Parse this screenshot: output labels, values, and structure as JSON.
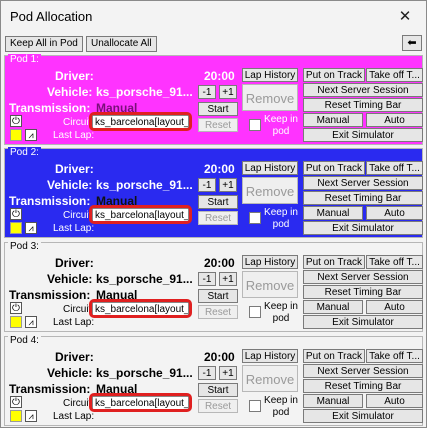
{
  "window": {
    "title": "Pod Allocation",
    "close_glyph": "✕"
  },
  "toolbar": {
    "keep_all_label": "Keep All in Pod",
    "unallocate_label": "Unallocate All",
    "back_glyph": "⬅"
  },
  "labels": {
    "driver": "Driver:",
    "vehicle": "Vehicle:",
    "transmission": "Transmission:",
    "circuit": "Circuit:",
    "last_lap": "Last Lap:",
    "lap_history": "Lap History",
    "minus": "-1",
    "plus": "+1",
    "start": "Start",
    "reset": "Reset",
    "remove": "Remove",
    "keep_in_pod": "Keep in pod",
    "put_on_track": "Put on Track",
    "take_off": "Take off T...",
    "next_server_session": "Next Server Session",
    "reset_timing_bar": "Reset Timing Bar",
    "manual_btn": "Manual",
    "auto_btn": "Auto",
    "exit_simulator": "Exit Simulator"
  },
  "pods": [
    {
      "label": "Pod 1:",
      "color": "#ff33ff",
      "driver": "",
      "vehicle": "ks_porsche_91...",
      "transmission": "Manual",
      "circuit": "ks_barcelona[layout_...",
      "last_lap": "",
      "time": "20:00"
    },
    {
      "label": "Pod 2:",
      "color": "#2a2af0",
      "driver": "",
      "vehicle": "ks_porsche_91...",
      "transmission": "Manual",
      "circuit": "ks_barcelona[layout_...",
      "last_lap": "",
      "time": "20:00"
    },
    {
      "label": "Pod 3:",
      "color": "#f3f3f3",
      "driver": "",
      "vehicle": "ks_porsche_91...",
      "transmission": "Manual",
      "circuit": "ks_barcelona[layout_...",
      "last_lap": "",
      "time": "20:00"
    },
    {
      "label": "Pod 4:",
      "color": "#f3f3f3",
      "driver": "",
      "vehicle": "ks_porsche_91...",
      "transmission": "Manual",
      "circuit": "ks_barcelona[layout_...",
      "last_lap": "",
      "time": "20:00"
    }
  ]
}
